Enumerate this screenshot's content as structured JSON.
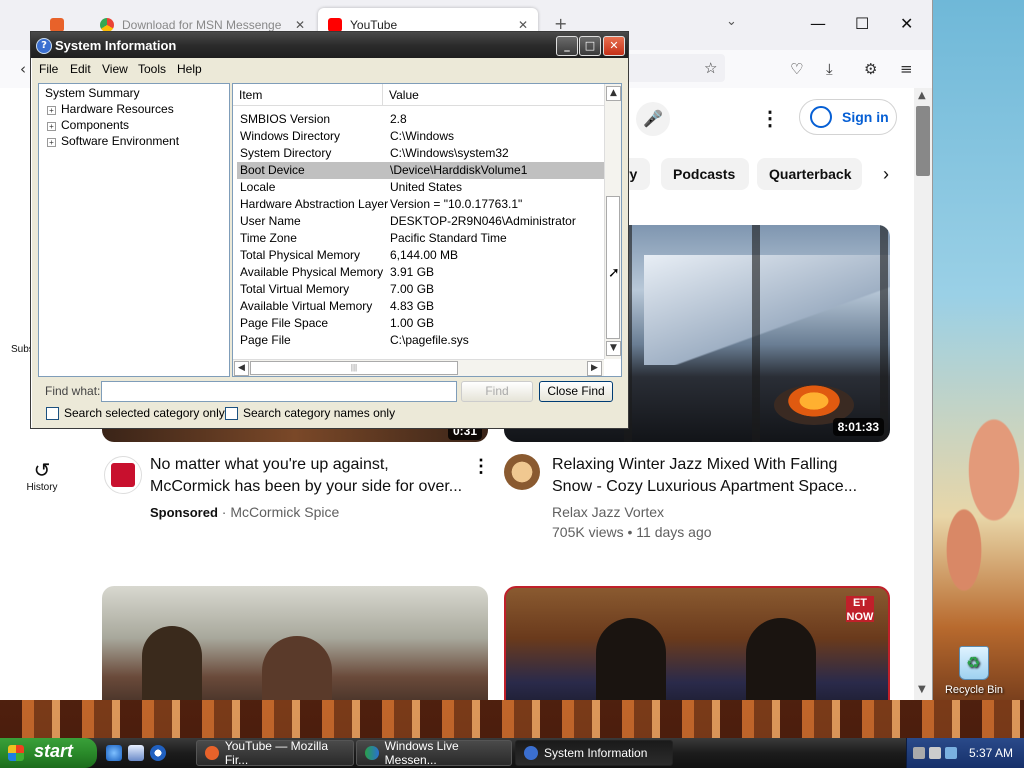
{
  "desktop": {
    "recycle_bin": "Recycle Bin"
  },
  "firefox": {
    "tabs": [
      {
        "label": ""
      },
      {
        "label": "Download for MSN Messenger | D"
      },
      {
        "label": "YouTube"
      }
    ],
    "new_tab": "+"
  },
  "youtube": {
    "sign_in": "Sign in",
    "chips": [
      "ry",
      "Podcasts",
      "Quarterback"
    ],
    "sidebar_sub": "Subs",
    "history": "History",
    "videos": [
      {
        "title_line1": "No matter what you're up against,",
        "title_line2": "McCormick has been by your side for over...",
        "sponsored": "Sponsored",
        "separator": "·",
        "channel": "McCormick Spice",
        "duration": "0:31"
      },
      {
        "title_line1": "Relaxing Winter Jazz Mixed With Falling",
        "title_line2": "Snow - Cozy Luxurious Apartment Space...",
        "channel": "Relax Jazz Vortex",
        "meta": "705K views • 11 days ago",
        "duration": "8:01:33"
      }
    ],
    "et_logo": "ET NOW"
  },
  "sysinfo": {
    "title": "System Information",
    "menu": [
      "File",
      "Edit",
      "View",
      "Tools",
      "Help"
    ],
    "tree": [
      {
        "label": "System Summary",
        "expander": ""
      },
      {
        "label": "Hardware Resources",
        "expander": "+"
      },
      {
        "label": "Components",
        "expander": "+"
      },
      {
        "label": "Software Environment",
        "expander": "+"
      }
    ],
    "columns": {
      "item": "Item",
      "value": "Value"
    },
    "rows": [
      {
        "item": "SMBIOS Version",
        "value": "2.8"
      },
      {
        "item": "Windows Directory",
        "value": "C:\\Windows"
      },
      {
        "item": "System Directory",
        "value": "C:\\Windows\\system32"
      },
      {
        "item": "Boot Device",
        "value": "\\Device\\HarddiskVolume1",
        "selected": true
      },
      {
        "item": "Locale",
        "value": "United States"
      },
      {
        "item": "Hardware Abstraction Layer",
        "value": "Version = \"10.0.17763.1\""
      },
      {
        "item": "User Name",
        "value": "DESKTOP-2R9N046\\Administrator"
      },
      {
        "item": "Time Zone",
        "value": "Pacific Standard Time"
      },
      {
        "item": "Total Physical Memory",
        "value": "6,144.00 MB"
      },
      {
        "item": "Available Physical Memory",
        "value": "3.91 GB"
      },
      {
        "item": "Total Virtual Memory",
        "value": "7.00 GB"
      },
      {
        "item": "Available Virtual Memory",
        "value": "4.83 GB"
      },
      {
        "item": "Page File Space",
        "value": "1.00 GB"
      },
      {
        "item": "Page File",
        "value": "C:\\pagefile.sys"
      }
    ],
    "find_label": "Find what:",
    "find_value": "",
    "find_button": "Find",
    "close_find_button": "Close Find",
    "chk_selected": "Search selected category only",
    "chk_names": "Search category names only"
  },
  "taskbar": {
    "start": "start",
    "tasks": [
      {
        "label": "YouTube — Mozilla Fir...",
        "active": false
      },
      {
        "label": "Windows Live Messen...",
        "active": false
      },
      {
        "label": "System Information",
        "active": true
      }
    ],
    "clock": "5:37 AM"
  },
  "colors": {
    "yt_blue": "#065fd4",
    "selection": "#c0c0c0",
    "xp_green": "#2a8a2a",
    "tray_blue": "#16306a"
  }
}
